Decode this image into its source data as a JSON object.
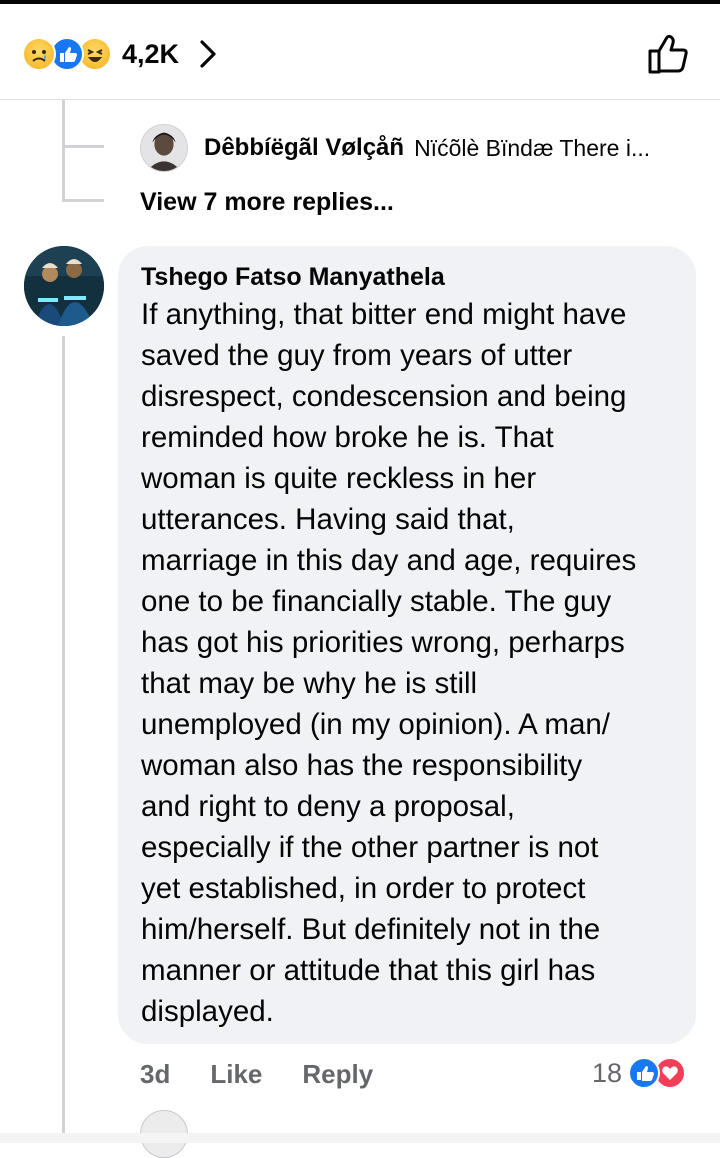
{
  "header": {
    "reaction_icons": [
      "sad-reaction-icon",
      "like-reaction-icon",
      "haha-reaction-icon"
    ],
    "reaction_count": "4,2K"
  },
  "reply_preview": {
    "author": "Dêbbíëgãl Vølçåñ",
    "snippet": "Nïćõlè Bïndæ There i..."
  },
  "view_more": "View 7 more replies...",
  "comment": {
    "author": "Tshego Fatso Manyathela",
    "lines": [
      "If anything, that bitter end might have",
      "saved the guy from years of utter",
      "disrespect, condescension and being",
      "reminded how broke he is. That",
      "woman is quite reckless in her",
      "utterances. Having said that,",
      "marriage in this day and age, requires",
      "one to be financially stable. The guy",
      "has got his priorities wrong, perharps",
      "that may be why he is still",
      "unemployed (in my opinion). A man/",
      "woman also has the responsibility",
      "and right to deny a proposal,",
      "especially if the other partner is not",
      "yet established, in order to protect",
      "him/herself. But definitely not in the",
      "manner or attitude that this girl has",
      "displayed."
    ],
    "time": "3d",
    "like_label": "Like",
    "reply_label": "Reply",
    "reaction_count": "18"
  },
  "colors": {
    "bubble": "#f0f2f5",
    "like_blue": "#1877f2",
    "love_red": "#f33e58",
    "secondary_text": "#65676b"
  }
}
